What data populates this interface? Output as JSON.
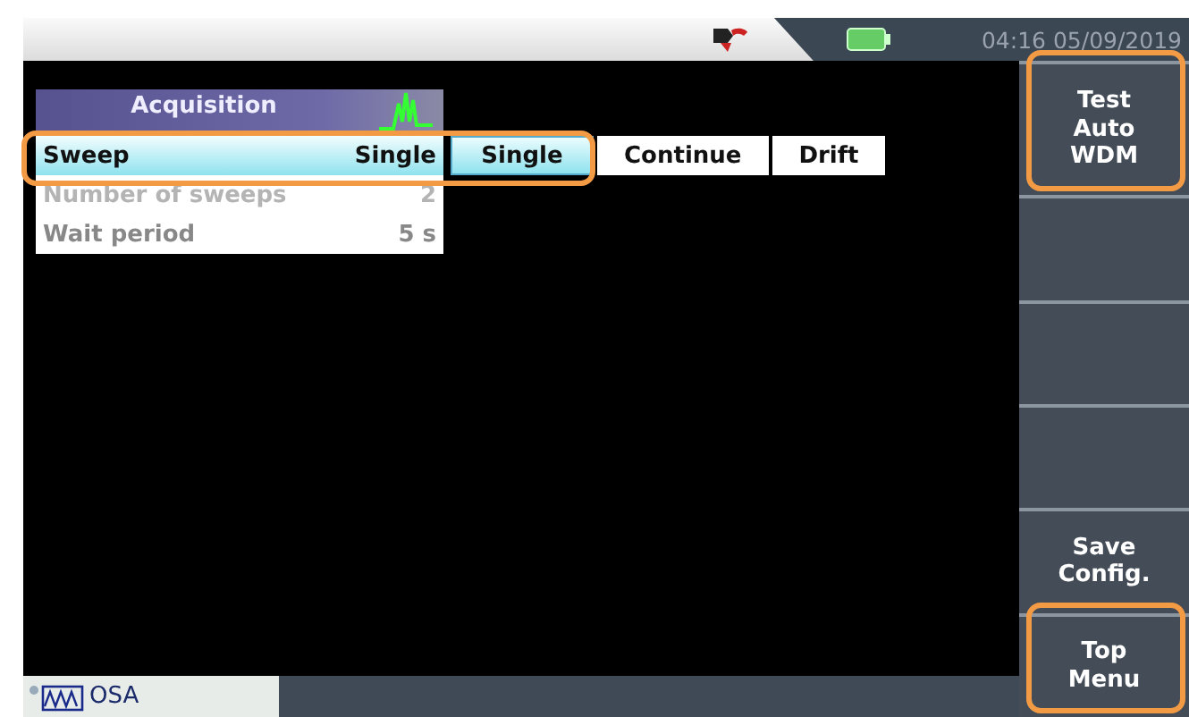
{
  "status_bar": {
    "datetime": "04:16 05/09/2019"
  },
  "menu": {
    "title": "Acquisition",
    "rows": [
      {
        "label": "Sweep",
        "value": "Single",
        "selected": true,
        "disabled": false,
        "highlighted": true
      },
      {
        "label": "Number of sweeps",
        "value": "2",
        "selected": false,
        "disabled": true,
        "highlighted": false
      },
      {
        "label": "Wait period",
        "value": "5 s",
        "selected": false,
        "disabled": false,
        "highlighted": false
      }
    ]
  },
  "options": [
    {
      "label": "Single",
      "selected": true
    },
    {
      "label": "Continue",
      "selected": false
    },
    {
      "label": "Drift",
      "selected": false
    }
  ],
  "soft_keys": [
    {
      "kind": "label",
      "lines": [
        "Test",
        "Auto",
        "WDM"
      ],
      "highlighted": true
    },
    {
      "kind": "blank"
    },
    {
      "kind": "blank"
    },
    {
      "kind": "blank"
    },
    {
      "kind": "label",
      "lines": [
        "Save",
        "Config."
      ],
      "highlighted": false
    },
    {
      "kind": "label",
      "lines": [
        "Top",
        "Menu"
      ],
      "highlighted": true
    }
  ],
  "taskbar": {
    "tabs": [
      {
        "label": "OSA",
        "selected": true
      }
    ]
  }
}
